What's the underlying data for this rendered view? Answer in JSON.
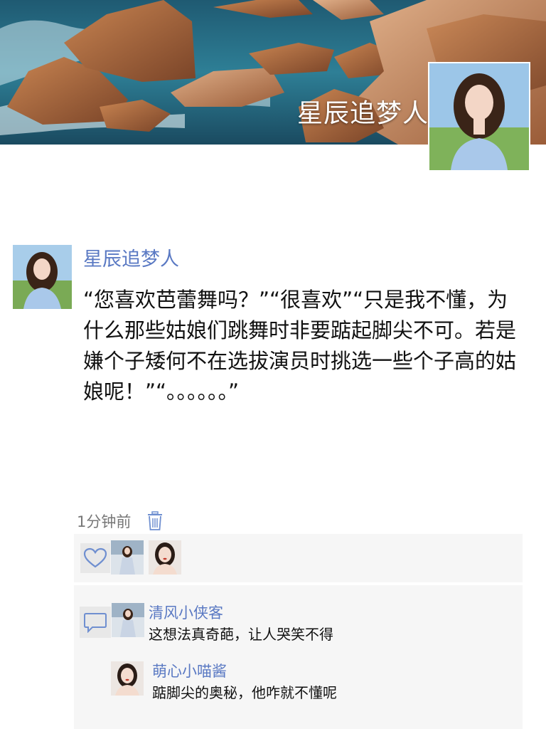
{
  "profile": {
    "cover_name": "星辰追梦人"
  },
  "post": {
    "author": "星辰追梦人",
    "text": "“您喜欢芭蕾舞吗？”“很喜欢”“只是我不懂，为什么那些姑娘们跳舞时非要踮起脚尖不可。若是嫌个子矮何不在选拔演员时挑选一些个子高的姑娘呢！”“。。。。。。”",
    "time": "1分钟前"
  },
  "comments": [
    {
      "author": "清风小侠客",
      "text": "这想法真奇葩，让人哭笑不得"
    },
    {
      "author": "萌心小喵酱",
      "text": "踮脚尖的奥秘，他咋就不懂呢"
    }
  ],
  "icons": {
    "delete": "trash-icon",
    "like": "heart-icon",
    "comment": "comment-bubble-icon"
  },
  "colors": {
    "name_link": "#5a79c3",
    "panel_bg": "#f6f6f6",
    "icon_blue": "#6f8fd0"
  }
}
